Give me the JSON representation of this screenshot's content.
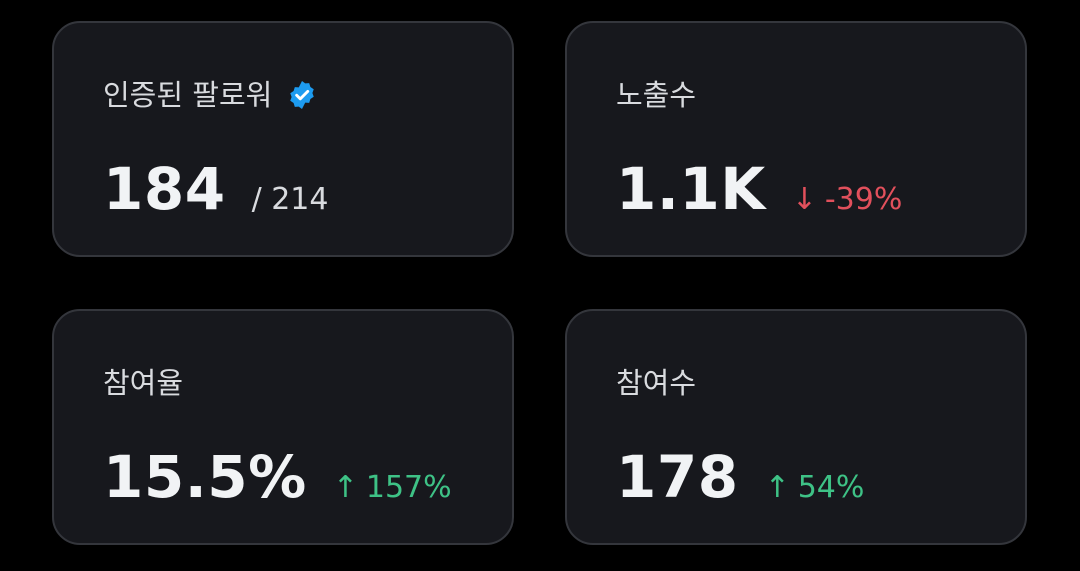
{
  "colors": {
    "background": "#000000",
    "card": "#17181d",
    "card_border": "#34363c",
    "positive": "#3ec286",
    "negative": "#e2505c",
    "verified_badge": "#1d9bf0"
  },
  "cards": [
    {
      "title": "인증된 팔로워",
      "icon": "verified-badge-icon",
      "value": "184",
      "sub": "/ 214"
    },
    {
      "title": "노출수",
      "value": "1.1K",
      "delta": {
        "direction": "down",
        "arrow": "↓",
        "text": "-39%"
      }
    },
    {
      "title": "참여율",
      "value": "15.5%",
      "delta": {
        "direction": "up",
        "arrow": "↑",
        "text": "157%"
      }
    },
    {
      "title": "참여수",
      "value": "178",
      "delta": {
        "direction": "up",
        "arrow": "↑",
        "text": "54%"
      }
    }
  ]
}
